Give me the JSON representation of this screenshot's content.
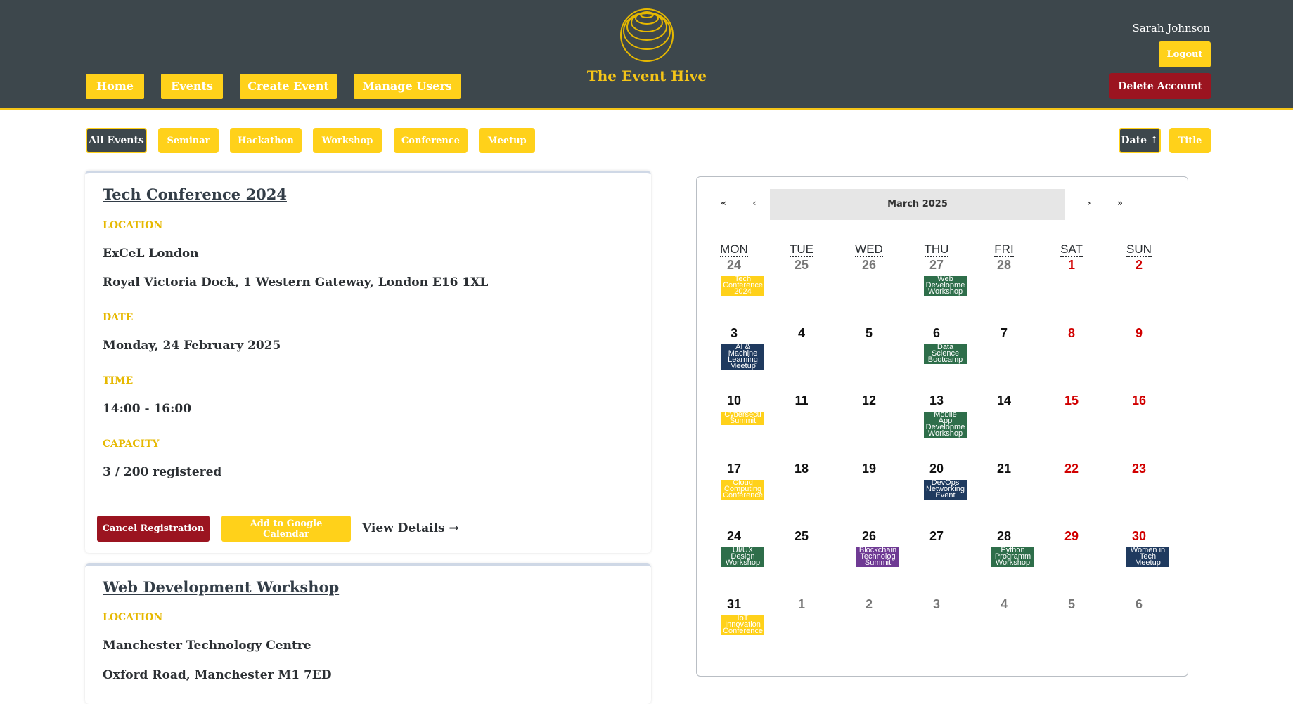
{
  "header": {
    "nav": [
      "Home",
      "Events",
      "Create Event",
      "Manage Users"
    ],
    "brand": "The Event Hive",
    "user_name": "Sarah Johnson",
    "logout": "Logout",
    "delete_account": "Delete Account"
  },
  "filters": {
    "categories": [
      "All Events",
      "Seminar",
      "Hackathon",
      "Workshop",
      "Conference",
      "Meetup"
    ],
    "active_category": "All Events",
    "sort": [
      "Date ↑",
      "Title"
    ],
    "active_sort": "Date ↑"
  },
  "events": [
    {
      "title": "Tech Conference 2024",
      "location_label": "LOCATION",
      "venue": "ExCeL London",
      "address": "Royal Victoria Dock, 1 Western Gateway, London E16 1XL",
      "date_label": "DATE",
      "date": "Monday, 24 February 2025",
      "time_label": "TIME",
      "time": "14:00 - 16:00",
      "capacity_label": "CAPACITY",
      "capacity": "3 / 200 registered",
      "cancel": "Cancel Registration",
      "google": "Add to Google Calendar",
      "details": "View Details →"
    },
    {
      "title": "Web Development Workshop",
      "location_label": "LOCATION",
      "venue": "Manchester Technology Centre",
      "address": "Oxford Road, Manchester M1 7ED"
    }
  ],
  "calendar": {
    "prev_year": "«",
    "prev_month": "‹",
    "month": "March 2025",
    "next_month": "›",
    "next_year": "»",
    "weekdays": [
      "MON",
      "TUE",
      "WED",
      "THU",
      "FRI",
      "SAT",
      "SUN"
    ],
    "weeks": [
      [
        {
          "d": "24",
          "m": true
        },
        {
          "d": "25",
          "m": true
        },
        {
          "d": "26",
          "m": true
        },
        {
          "d": "27",
          "m": true
        },
        {
          "d": "28",
          "m": true
        },
        {
          "d": "1",
          "w": true
        },
        {
          "d": "2",
          "w": true
        }
      ],
      [
        {
          "d": "3"
        },
        {
          "d": "4"
        },
        {
          "d": "5"
        },
        {
          "d": "6"
        },
        {
          "d": "7"
        },
        {
          "d": "8",
          "w": true
        },
        {
          "d": "9",
          "w": true
        }
      ],
      [
        {
          "d": "10"
        },
        {
          "d": "11"
        },
        {
          "d": "12"
        },
        {
          "d": "13"
        },
        {
          "d": "14"
        },
        {
          "d": "15",
          "w": true
        },
        {
          "d": "16",
          "w": true
        }
      ],
      [
        {
          "d": "17"
        },
        {
          "d": "18"
        },
        {
          "d": "19"
        },
        {
          "d": "20"
        },
        {
          "d": "21"
        },
        {
          "d": "22",
          "w": true
        },
        {
          "d": "23",
          "w": true
        }
      ],
      [
        {
          "d": "24"
        },
        {
          "d": "25"
        },
        {
          "d": "26"
        },
        {
          "d": "27"
        },
        {
          "d": "28"
        },
        {
          "d": "29",
          "w": true
        },
        {
          "d": "30",
          "w": true
        }
      ],
      [
        {
          "d": "31"
        },
        {
          "d": "1",
          "m": true
        },
        {
          "d": "2",
          "m": true
        },
        {
          "d": "3",
          "m": true
        },
        {
          "d": "4",
          "m": true
        },
        {
          "d": "5",
          "m": true
        },
        {
          "d": "6",
          "m": true
        }
      ]
    ],
    "events": [
      {
        "week": 0,
        "col": 0,
        "lines": [
          "Tech",
          "Conference",
          "2024"
        ],
        "color": "#ffd11a"
      },
      {
        "week": 0,
        "col": 3,
        "lines": [
          "Web",
          "Developme",
          "Workshop"
        ],
        "color": "#2e6e4a"
      },
      {
        "week": 1,
        "col": 0,
        "lines": [
          "AI &",
          "Machine",
          "Learning",
          "Meetup"
        ],
        "color": "#1f3a5f"
      },
      {
        "week": 1,
        "col": 3,
        "lines": [
          "Data",
          "Science",
          "Bootcamp"
        ],
        "color": "#2e6e4a"
      },
      {
        "week": 2,
        "col": 0,
        "lines": [
          "Cybersecu",
          "Summit"
        ],
        "color": "#ffd11a"
      },
      {
        "week": 2,
        "col": 3,
        "lines": [
          "Mobile",
          "App",
          "Developme",
          "Workshop"
        ],
        "color": "#2e6e4a"
      },
      {
        "week": 3,
        "col": 0,
        "lines": [
          "Cloud",
          "Computing",
          "Conference"
        ],
        "color": "#ffd11a"
      },
      {
        "week": 3,
        "col": 3,
        "lines": [
          "DevOps",
          "Networking",
          "Event"
        ],
        "color": "#1f3a5f"
      },
      {
        "week": 4,
        "col": 0,
        "lines": [
          "UI/UX",
          "Design",
          "Workshop"
        ],
        "color": "#2e6e4a"
      },
      {
        "week": 4,
        "col": 2,
        "lines": [
          "Blockchain",
          "Technolog",
          "Summit"
        ],
        "color": "#6f3a94"
      },
      {
        "week": 4,
        "col": 4,
        "lines": [
          "Python",
          "Programm",
          "Workshop"
        ],
        "color": "#2e6e4a"
      },
      {
        "week": 4,
        "col": 6,
        "lines": [
          "Women in",
          "Tech",
          "Meetup"
        ],
        "color": "#1f3a5f"
      },
      {
        "week": 5,
        "col": 0,
        "lines": [
          "IoT",
          "Innovation",
          "Conference"
        ],
        "color": "#ffd11a"
      }
    ]
  }
}
